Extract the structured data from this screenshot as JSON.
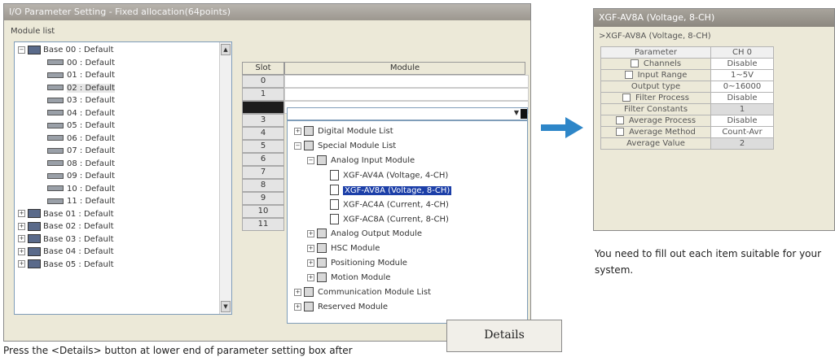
{
  "window": {
    "title": "I/O Parameter Setting - Fixed allocation(64points)",
    "module_list_label": "Module list"
  },
  "tree": {
    "base": "Base 00 : Default",
    "slots": [
      "00 : Default",
      "01 : Default",
      "02 : Default",
      "03 : Default",
      "04 : Default",
      "05 : Default",
      "06 : Default",
      "07 : Default",
      "08 : Default",
      "09 : Default",
      "10 : Default",
      "11 : Default"
    ],
    "other_bases": [
      "Base 01 : Default",
      "Base 02 : Default",
      "Base 03 : Default",
      "Base 04 : Default",
      "Base 05 : Default"
    ],
    "selected_slot_index": 2
  },
  "grid": {
    "headers": {
      "slot": "Slot",
      "module": "Module"
    },
    "slots": [
      "0",
      "1",
      "2",
      "3",
      "4",
      "5",
      "6",
      "7",
      "8",
      "9",
      "10",
      "11"
    ],
    "selected_slot": "2"
  },
  "dropdown": {
    "items": [
      {
        "label": "Digital Module List",
        "kind": "group",
        "indent": 0,
        "toggle": "+"
      },
      {
        "label": "Special Module List",
        "kind": "group",
        "indent": 0,
        "toggle": "-"
      },
      {
        "label": "Analog Input Module",
        "kind": "group",
        "indent": 1,
        "toggle": "-"
      },
      {
        "label": "XGF-AV4A (Voltage, 4-CH)",
        "kind": "module",
        "indent": 2,
        "toggle": ""
      },
      {
        "label": "XGF-AV8A (Voltage, 8-CH)",
        "kind": "module",
        "indent": 2,
        "toggle": "",
        "selected": true
      },
      {
        "label": "XGF-AC4A (Current, 4-CH)",
        "kind": "module",
        "indent": 2,
        "toggle": ""
      },
      {
        "label": "XGF-AC8A (Current, 8-CH)",
        "kind": "module",
        "indent": 2,
        "toggle": ""
      },
      {
        "label": "Analog Output Module",
        "kind": "group",
        "indent": 1,
        "toggle": "+"
      },
      {
        "label": "HSC Module",
        "kind": "group",
        "indent": 1,
        "toggle": "+"
      },
      {
        "label": "Positioning Module",
        "kind": "group",
        "indent": 1,
        "toggle": "+"
      },
      {
        "label": "Motion Module",
        "kind": "group",
        "indent": 1,
        "toggle": "+"
      },
      {
        "label": "Communication Module List",
        "kind": "group",
        "indent": 0,
        "toggle": "+"
      },
      {
        "label": "Reserved Module",
        "kind": "group",
        "indent": 0,
        "toggle": "+"
      }
    ]
  },
  "details_button": "Details",
  "caption_left": "Press the <Details> button at lower end of parameter setting box after",
  "param_window": {
    "title": "XGF-AV8A (Voltage, 8-CH)",
    "subtitle": ">XGF-AV8A (Voltage, 8-CH)",
    "header": {
      "parameter": "Parameter",
      "ch": "CH 0"
    },
    "rows": [
      {
        "name": "Channels",
        "check": true,
        "value": "Disable"
      },
      {
        "name": "Input Range",
        "check": true,
        "value": "1~5V"
      },
      {
        "name": "Output type",
        "check": false,
        "value": "0~16000"
      },
      {
        "name": "Filter Process",
        "check": true,
        "value": "Disable"
      },
      {
        "name": "Filter Constants",
        "check": false,
        "value": "1",
        "shade": true
      },
      {
        "name": "Average Process",
        "check": true,
        "value": "Disable"
      },
      {
        "name": "Average Method",
        "check": true,
        "value": "Count-Avr"
      },
      {
        "name": "Average Value",
        "check": false,
        "value": "2",
        "shade": true
      }
    ]
  },
  "caption_right": "You need to fill out each item suitable for your system.",
  "colors": {
    "accent_arrow": "#2e86c8",
    "selection": "#1c3fa8"
  }
}
